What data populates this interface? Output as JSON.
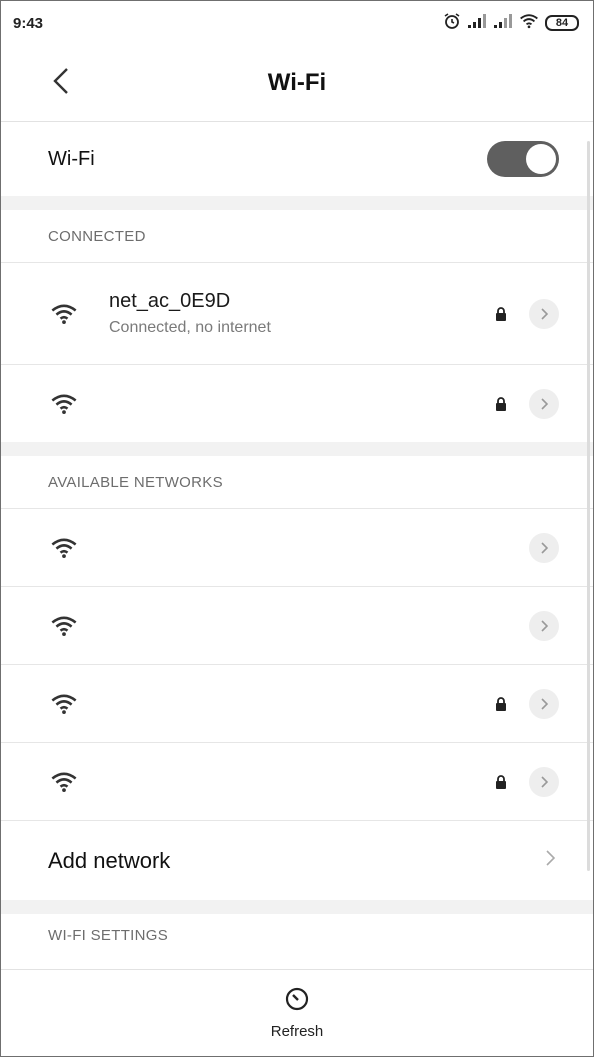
{
  "status_bar": {
    "time": "9:43",
    "battery": "84",
    "icons": [
      "alarm-icon",
      "signal-icon",
      "signal-icon",
      "wifi-icon",
      "battery-icon"
    ]
  },
  "app_bar": {
    "title": "Wi-Fi",
    "back_icon": "chevron-left-icon"
  },
  "wifi_toggle": {
    "label": "Wi-Fi",
    "state": "on"
  },
  "connected": {
    "header": "CONNECTED",
    "networks": [
      {
        "name": "net_ac_0E9D",
        "status": "Connected, no internet",
        "secured": true
      },
      {
        "name": "",
        "status": "",
        "secured": true
      }
    ]
  },
  "available": {
    "header": "AVAILABLE NETWORKS",
    "networks": [
      {
        "name": "",
        "secured": false
      },
      {
        "name": "",
        "secured": false
      },
      {
        "name": "",
        "secured": true
      },
      {
        "name": "",
        "secured": true
      }
    ]
  },
  "add_network": {
    "label": "Add network"
  },
  "settings": {
    "header": "WI-FI SETTINGS"
  },
  "bottom_bar": {
    "refresh_label": "Refresh"
  },
  "colors": {
    "toggle_on": "#5f5f5f",
    "divider": "#e6e6e6",
    "section_bg": "#f2f2f2"
  }
}
